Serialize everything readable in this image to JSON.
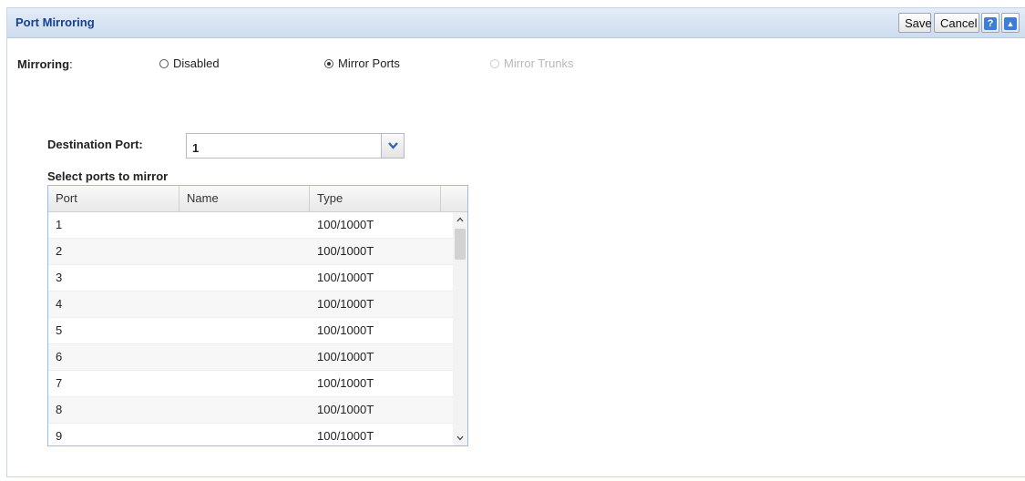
{
  "header": {
    "title": "Port Mirroring",
    "save_label": "Save",
    "cancel_label": "Cancel",
    "help_label": "?",
    "collapse_label": "▲"
  },
  "mirroring": {
    "label": "Mirroring",
    "label_suffix": ":",
    "options": [
      {
        "label": "Disabled",
        "selected": false,
        "enabled": true
      },
      {
        "label": "Mirror Ports",
        "selected": true,
        "enabled": true
      },
      {
        "label": "Mirror Trunks",
        "selected": false,
        "enabled": false
      }
    ]
  },
  "destination": {
    "label": "Destination Port:",
    "value": "1"
  },
  "ports_table": {
    "title": "Select ports to mirror",
    "columns": [
      "Port",
      "Name",
      "Type"
    ],
    "rows": [
      {
        "port": "1",
        "name": "",
        "type": "100/1000T"
      },
      {
        "port": "2",
        "name": "",
        "type": "100/1000T"
      },
      {
        "port": "3",
        "name": "",
        "type": "100/1000T"
      },
      {
        "port": "4",
        "name": "",
        "type": "100/1000T"
      },
      {
        "port": "5",
        "name": "",
        "type": "100/1000T"
      },
      {
        "port": "6",
        "name": "",
        "type": "100/1000T"
      },
      {
        "port": "7",
        "name": "",
        "type": "100/1000T"
      },
      {
        "port": "8",
        "name": "",
        "type": "100/1000T"
      },
      {
        "port": "9",
        "name": "",
        "type": "100/1000T"
      }
    ]
  },
  "icons": {
    "dropdown": "chevron-down-icon",
    "help": "help-icon",
    "collapse": "collapse-up-icon",
    "scroll_up": "scroll-up-icon",
    "scroll_down": "scroll-down-icon"
  },
  "colors": {
    "header_title": "#15428b",
    "accent": "#3c7dd9",
    "grid_border": "#99bce8"
  }
}
